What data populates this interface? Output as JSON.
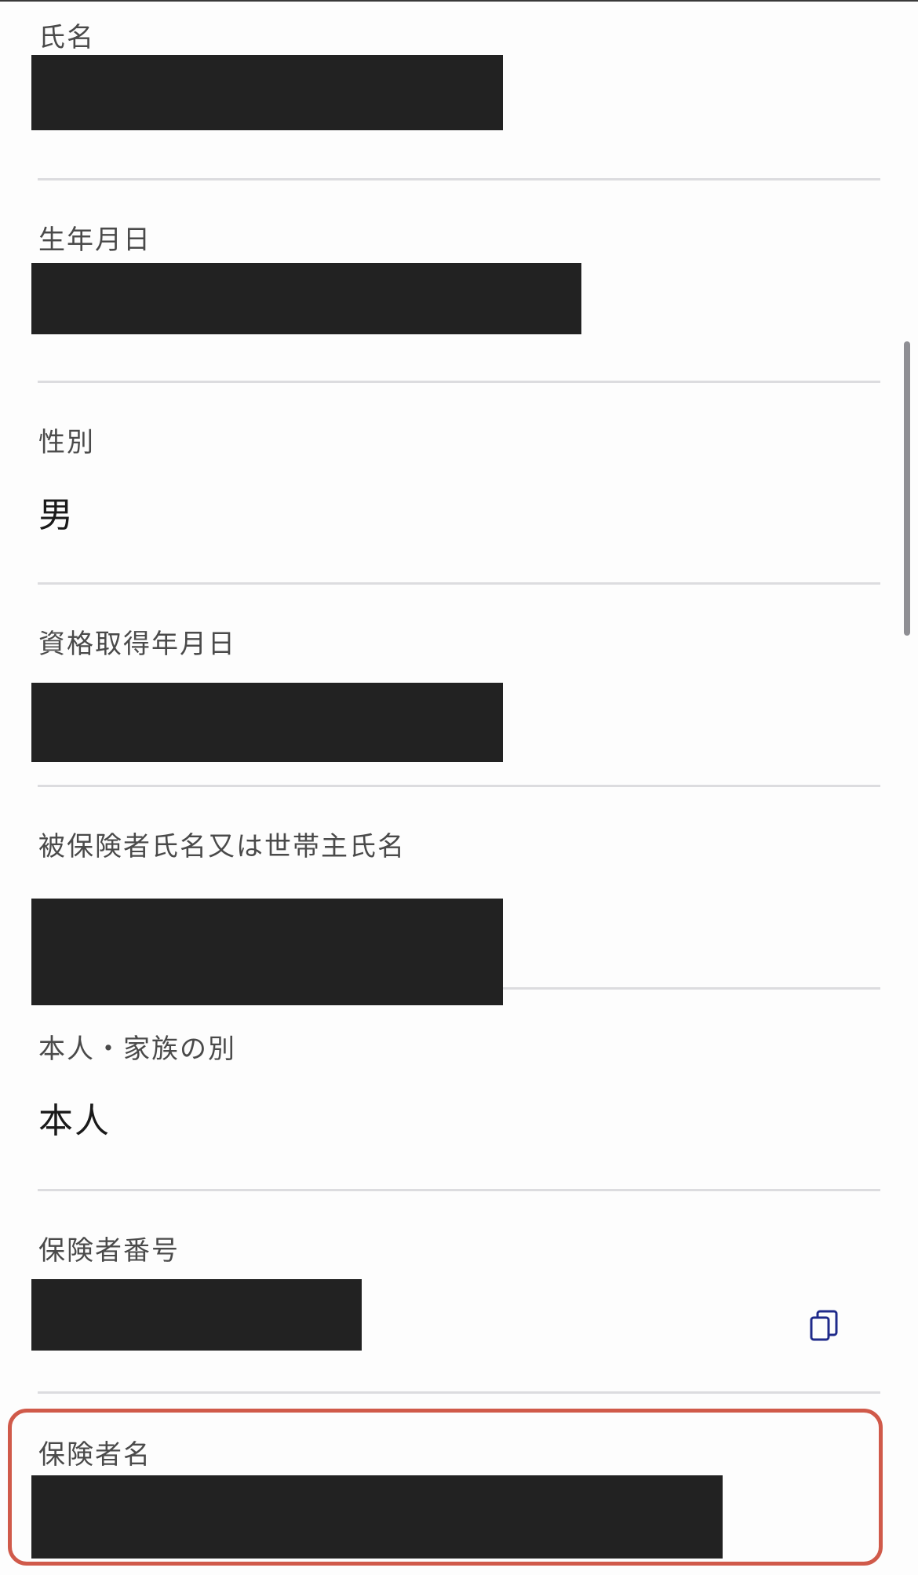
{
  "fields": {
    "name": {
      "label": "氏名"
    },
    "birthdate": {
      "label": "生年月日"
    },
    "sex": {
      "label": "性別",
      "value": "男"
    },
    "qualification_date": {
      "label": "資格取得年月日"
    },
    "insured_name": {
      "label": "被保険者氏名又は世帯主氏名"
    },
    "relationship": {
      "label": "本人・家族の別",
      "value": "本人"
    },
    "insurer_number": {
      "label": "保険者番号"
    },
    "insurer_name": {
      "label": "保険者名"
    }
  },
  "icons": {
    "copy": "copy-icon"
  },
  "colors": {
    "highlight_border": "#d05a4a",
    "copy_icon": "#1f2a8a",
    "redaction": "#222222"
  }
}
